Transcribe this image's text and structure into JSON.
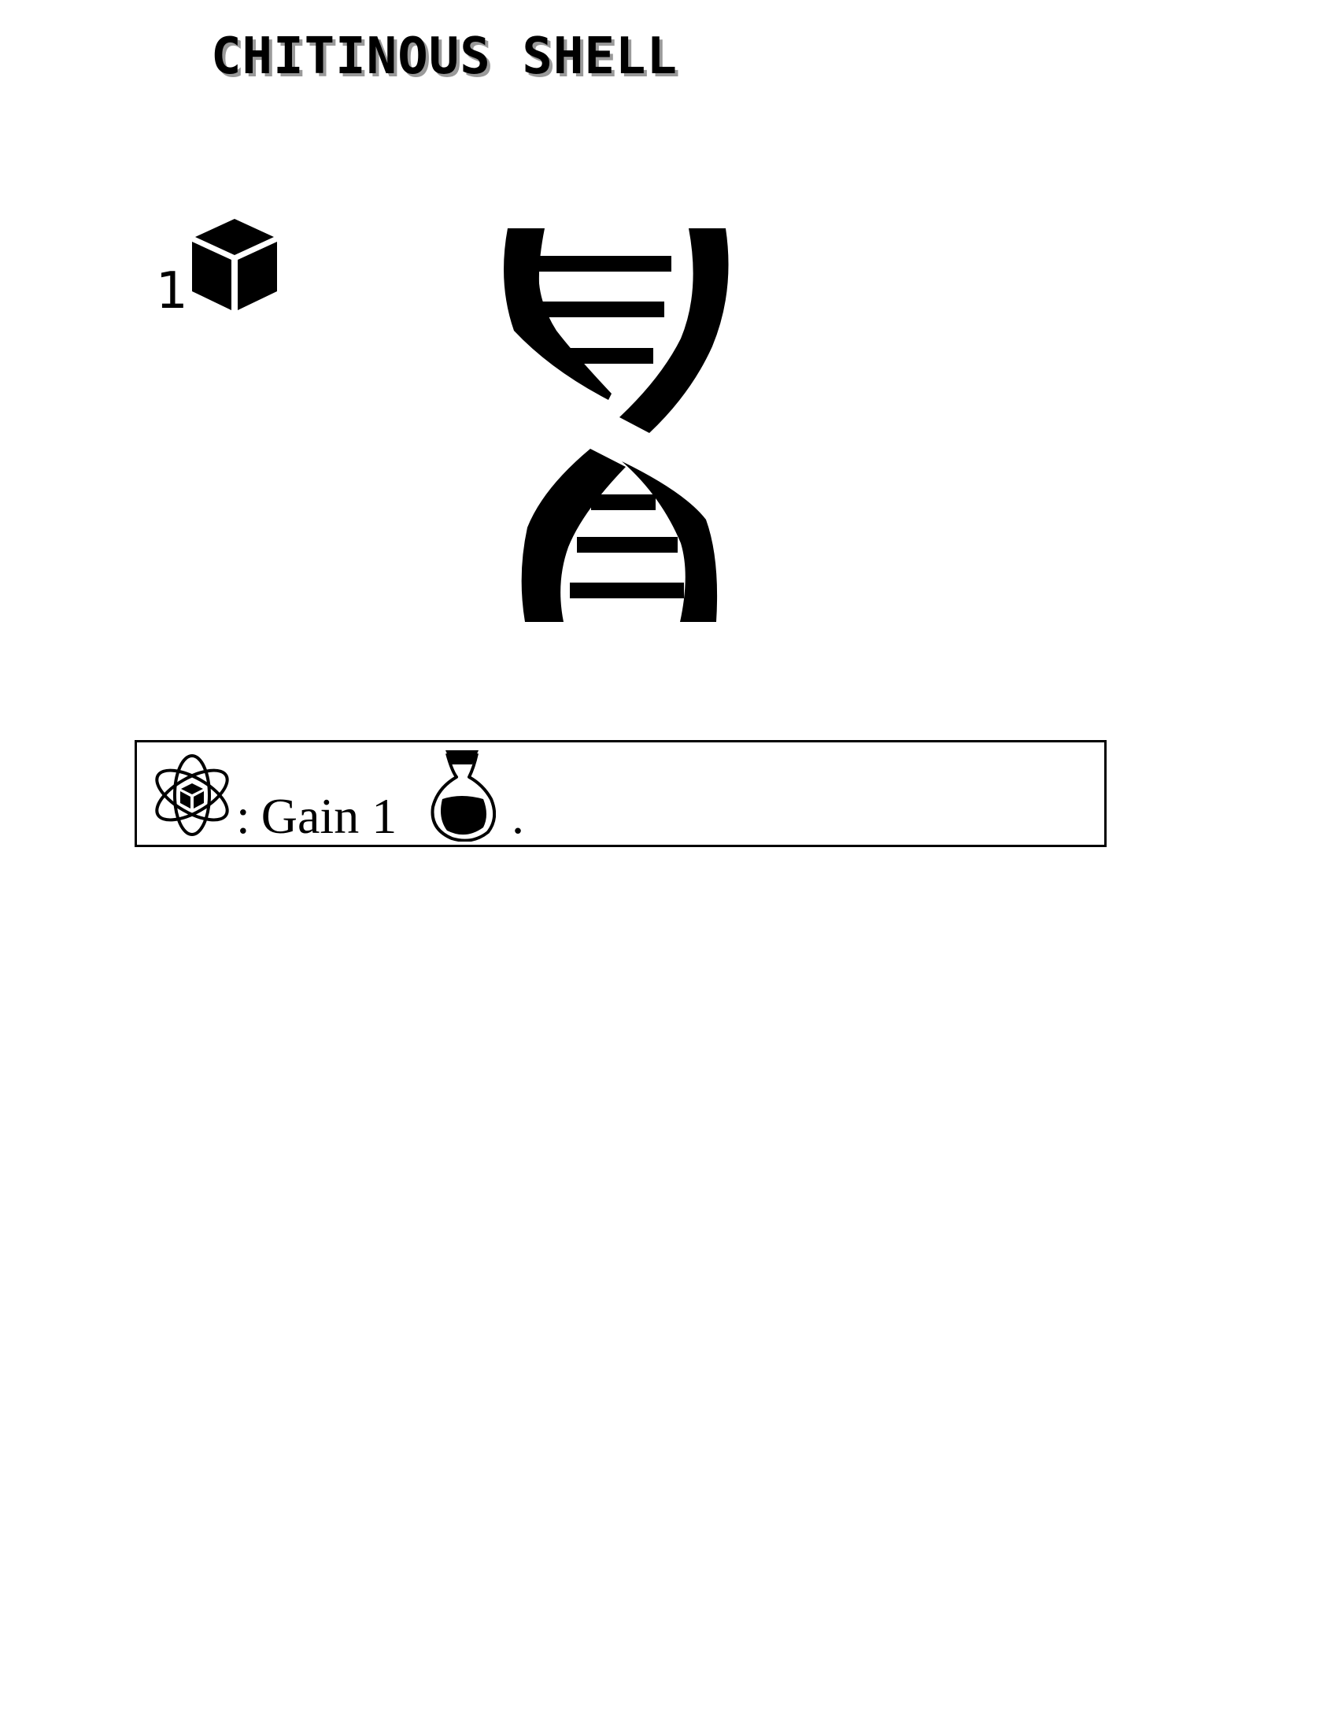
{
  "card": {
    "title": "CHITINOUS SHELL",
    "cost": {
      "value": "1",
      "icon": "cube-icon"
    },
    "art_icon": "dna-helix-icon",
    "ability": {
      "trigger_icon": "atom-cube-icon",
      "separator": ":",
      "text": "Gain 1",
      "resource_icon": "flask-icon",
      "end": "."
    }
  }
}
